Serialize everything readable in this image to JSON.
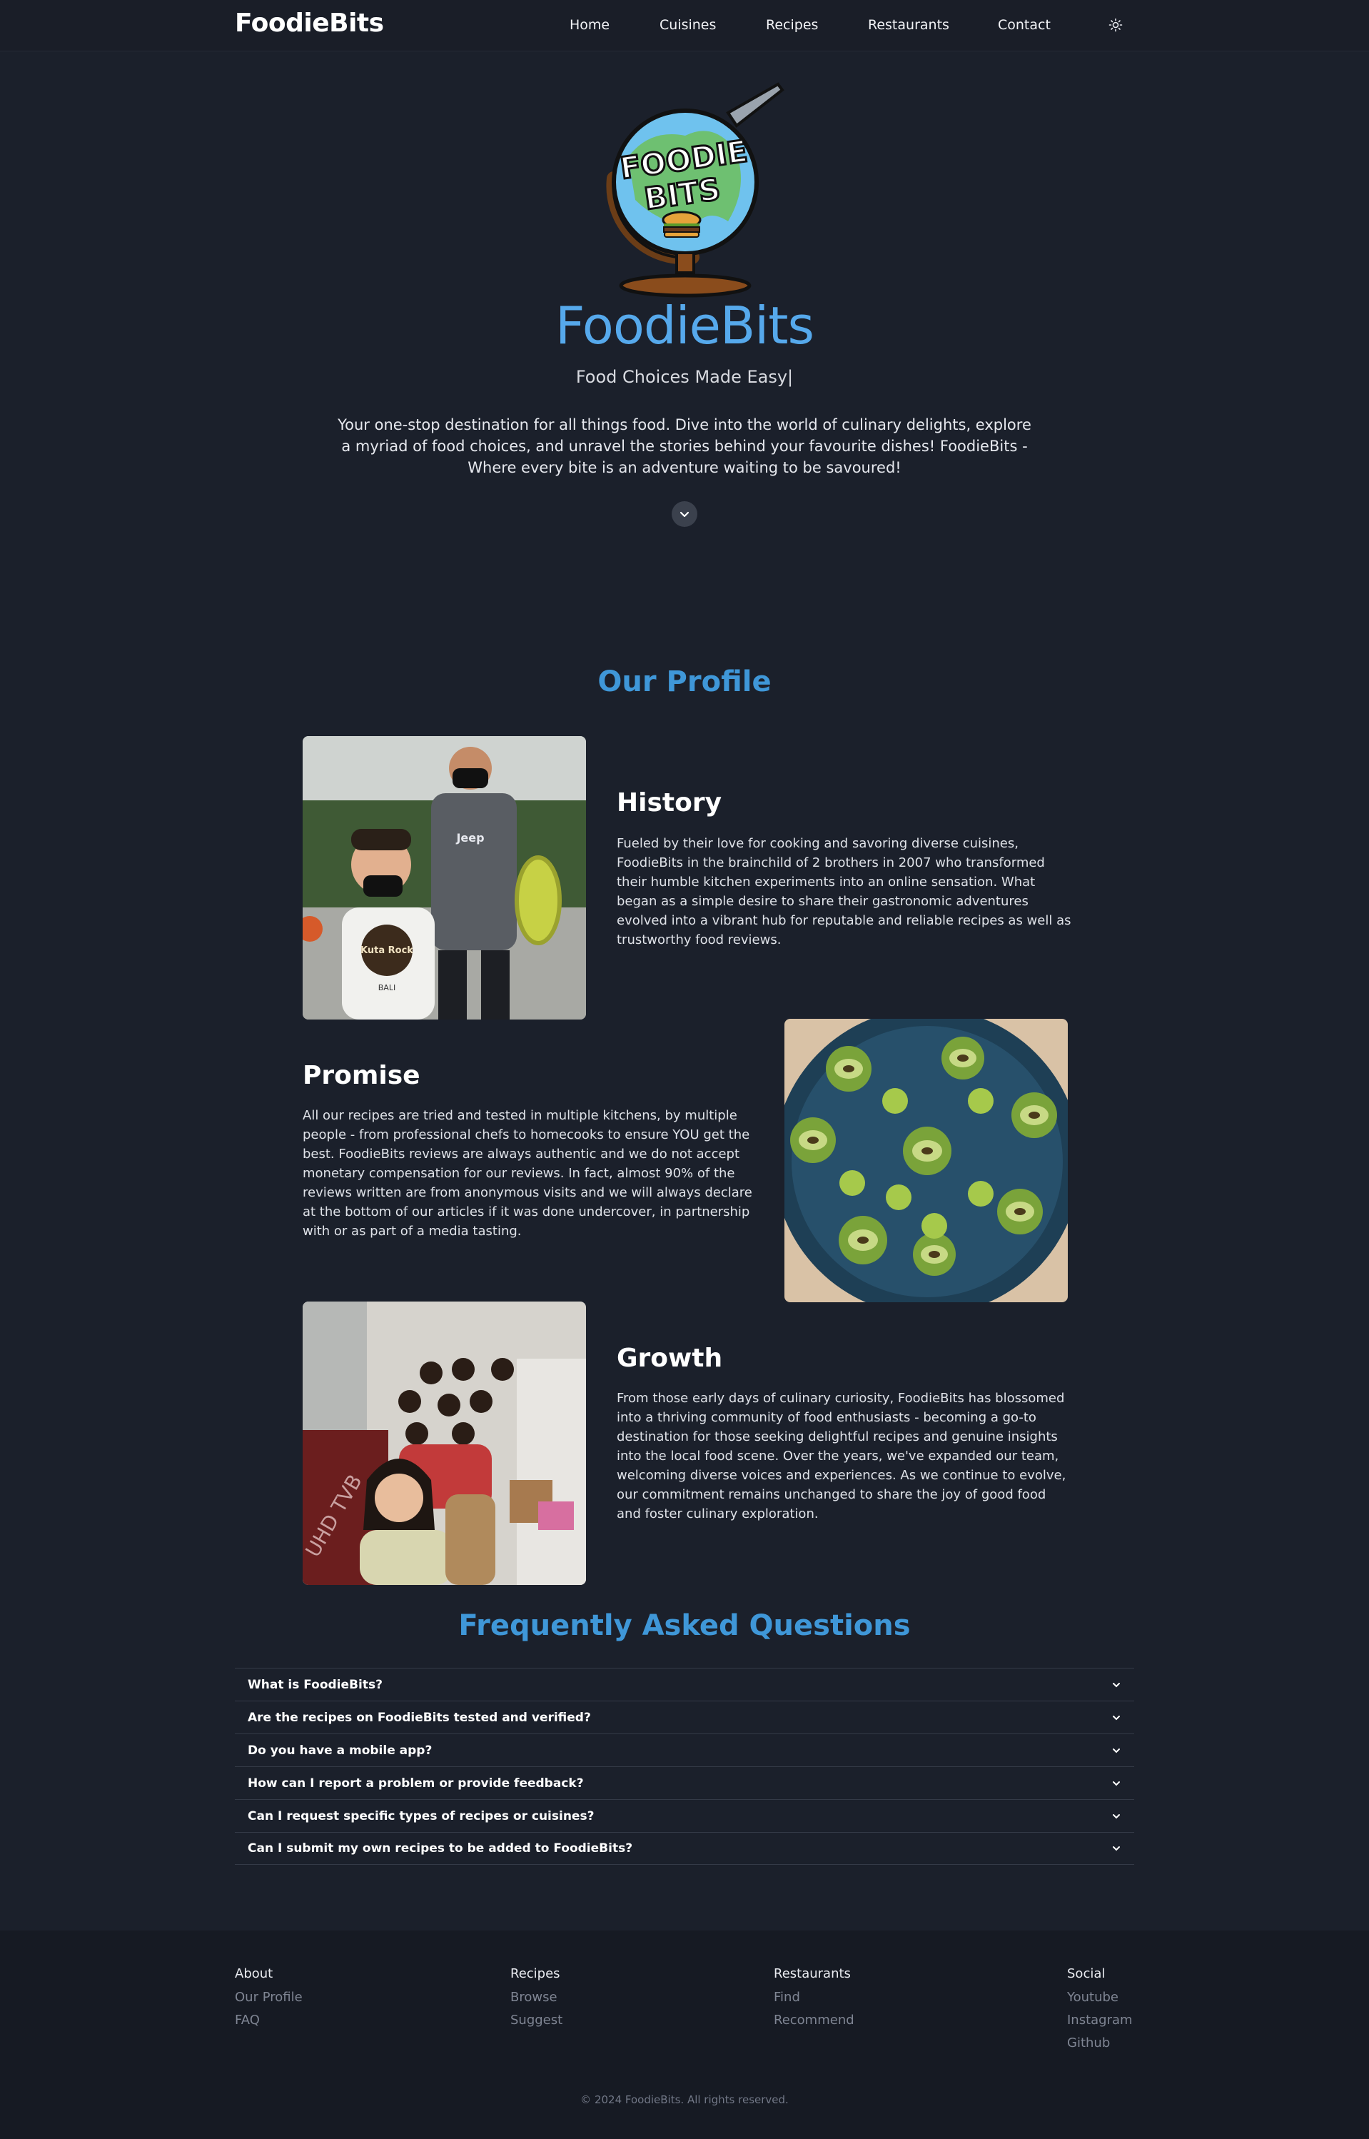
{
  "nav": {
    "brand": "FoodieBits",
    "links": [
      "Home",
      "Cuisines",
      "Recipes",
      "Restaurants",
      "Contact"
    ],
    "theme_icon": "sun-icon"
  },
  "hero": {
    "logo_text_top": "FOODIE",
    "logo_text_bottom": "BITS",
    "title": "FoodieBits",
    "tagline": "Food Choices Made Easy|",
    "description": "Your one-stop destination for all things food. Dive into the world of culinary delights, explore a myriad of food choices, and unravel the stories behind your favourite dishes! FoodieBits - Where every bite is an adventure waiting to be savoured!",
    "scroll_icon": "chevron-down-icon"
  },
  "profile": {
    "title": "Our Profile",
    "items": [
      {
        "heading": "History",
        "text": "Fueled by their love for cooking and savoring diverse cuisines, FoodieBits in the brainchild of 2 brothers in 2007 who transformed their humble kitchen experiments into an online sensation. What began as a simple desire to share their gastronomic adventures evolved into a vibrant hub for reputable and reliable recipes as well as trustworthy food reviews.",
        "photo_shirt_text": "Jeep",
        "photo_tee_text": "Kuta Rock",
        "photo_tee_sub": "BALI"
      },
      {
        "heading": "Promise",
        "text": "All our recipes are tried and tested in multiple kitchens, by multiple people - from professional chefs to homecooks to ensure YOU get the best. FoodieBits reviews are always authentic and we do not accept monetary compensation for our reviews. In fact, almost 90% of the reviews written are from anonymous visits and we will always declare at the bottom of our articles if it was done undercover, in partnership with or as part of a media tasting."
      },
      {
        "heading": "Growth",
        "text": "From those early days of culinary curiosity, FoodieBits has blossomed into a thriving community of food enthusiasts - becoming a go-to destination for those seeking delightful recipes and genuine insights into the local food scene. Over the years, we've expanded our team, welcoming diverse voices and experiences. As we continue to evolve, our commitment remains unchanged to share the joy of good food and foster culinary exploration.",
        "photo_box_text": "UHD TVB"
      }
    ]
  },
  "faq": {
    "title": "Frequently Asked Questions",
    "questions": [
      "What is FoodieBits?",
      "Are the recipes on FoodieBits tested and verified?",
      "Do you have a mobile app?",
      "How can I report a problem or provide feedback?",
      "Can I request specific types of recipes or cuisines?",
      "Can I submit my own recipes to be added to FoodieBits?"
    ]
  },
  "footer": {
    "columns": [
      {
        "heading": "About",
        "links": [
          "Our Profile",
          "FAQ"
        ]
      },
      {
        "heading": "Recipes",
        "links": [
          "Browse",
          "Suggest"
        ]
      },
      {
        "heading": "Restaurants",
        "links": [
          "Find",
          "Recommend"
        ]
      },
      {
        "heading": "Social",
        "links": [
          "Youtube",
          "Instagram",
          "Github"
        ]
      }
    ],
    "copyright": "© 2024 FoodieBits. All rights reserved."
  }
}
